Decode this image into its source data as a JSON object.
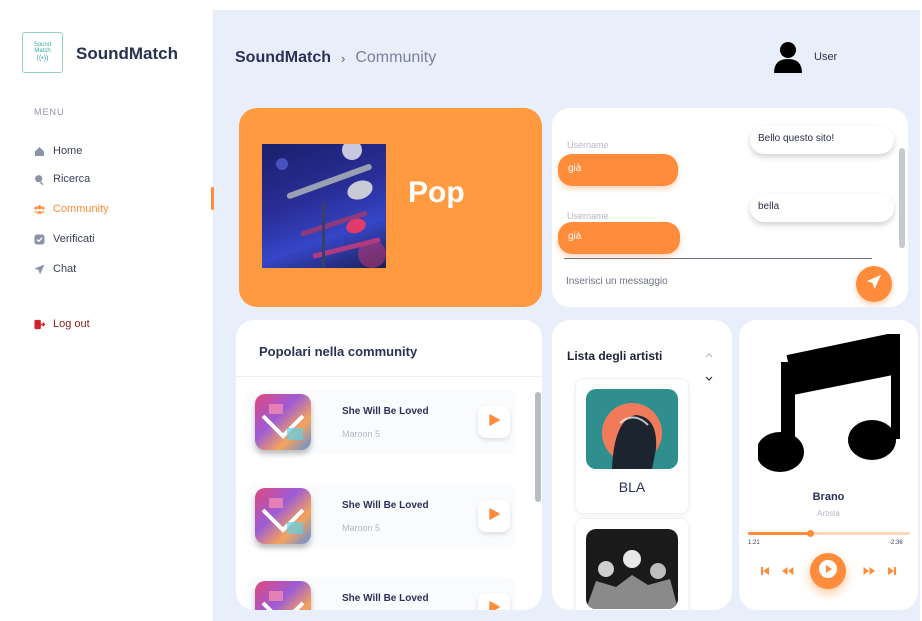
{
  "app": {
    "brand": "SoundMatch",
    "logo_line1": "Sound",
    "logo_line2": "Match"
  },
  "sidebar": {
    "menu_label": "MENU",
    "items": [
      {
        "label": "Home",
        "icon": "home-icon"
      },
      {
        "label": "Ricerca",
        "icon": "search-icon"
      },
      {
        "label": "Community",
        "icon": "community-icon",
        "active": true
      },
      {
        "label": "Verificati",
        "icon": "verified-icon"
      },
      {
        "label": "Chat",
        "icon": "send-icon"
      }
    ],
    "logout_label": "Log out"
  },
  "header": {
    "breadcrumb_root": "SoundMatch",
    "breadcrumb_sep": "›",
    "breadcrumb_current": "Community",
    "user_name": "User"
  },
  "genre_card": {
    "title": "Pop",
    "image": "microphone-photo"
  },
  "chat": {
    "messages": [
      {
        "username_label": "Username",
        "text": "già",
        "side": "left"
      },
      {
        "username_label": "Username",
        "text": "già",
        "side": "left"
      }
    ],
    "replies": [
      {
        "text": "Bello questo sito!"
      },
      {
        "text": "bella"
      }
    ],
    "input_placeholder": "Inserisci un messaggio"
  },
  "popular": {
    "title": "Popolari nella community",
    "songs": [
      {
        "title": "She Will Be Loved",
        "artist": "Maroon 5"
      },
      {
        "title": "She Will Be Loved",
        "artist": "Maroon 5"
      },
      {
        "title": "She Will Be Loved",
        "artist": ""
      }
    ]
  },
  "artists": {
    "title": "Lista degli artisti",
    "items": [
      {
        "name": "BLA"
      },
      {
        "name": ""
      }
    ]
  },
  "player": {
    "track": "Brano",
    "artist": "Artista",
    "time_current": "1:21",
    "time_total": "-2:36",
    "progress": 0.38
  },
  "colors": {
    "accent": "#ff8c3a",
    "pop_card": "#ff9a40",
    "background": "#e9effa",
    "logout": "#8a1c1c"
  }
}
